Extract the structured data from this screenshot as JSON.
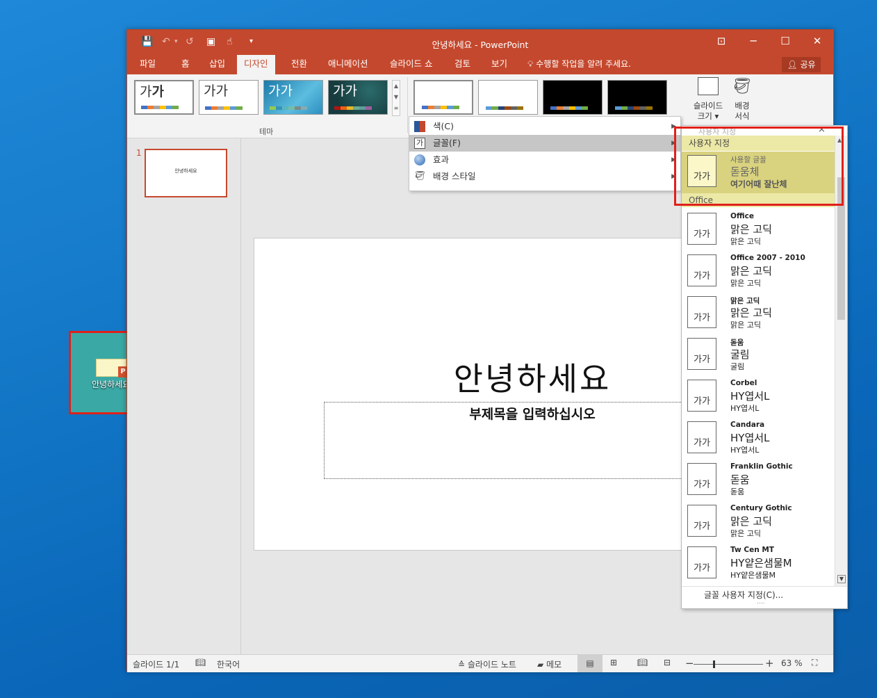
{
  "window": {
    "title": "안녕하세요 - PowerPoint",
    "minimize": "─",
    "maximize": "☐",
    "close": "✕",
    "ribbon_display": "⊡"
  },
  "qat": {
    "save": "💾",
    "undo": "↶",
    "undo_drop": "▾",
    "redo": "↺",
    "present": "▣",
    "touch": "☝",
    "customize": "▾"
  },
  "tabs": [
    "파일",
    "홈",
    "삽입",
    "디자인",
    "전환",
    "애니메이션",
    "슬라이드 쇼",
    "검토",
    "보기"
  ],
  "active_tab": "디자인",
  "tell_me": "수행할 작업을 알려 주세요.",
  "share": "공유",
  "themes": {
    "label": "테마",
    "items": [
      {
        "text": "가가",
        "bold_second": true
      },
      {
        "text": "가가"
      },
      {
        "text": "가가"
      },
      {
        "text": "가가"
      }
    ]
  },
  "customize_group": {
    "slide_size": "슬라이드 크기",
    "format_bg": "배경 서식",
    "size_line1": "슬라이드",
    "size_line2": "크기",
    "bg_line1": "배경",
    "bg_line2": "서식"
  },
  "variant_menu": {
    "items": [
      {
        "label": "색(C)",
        "name": "colors"
      },
      {
        "label": "글꼴(F)",
        "name": "fonts"
      },
      {
        "label": "효과",
        "name": "effects"
      },
      {
        "label": "배경 스타일",
        "name": "bg-styles"
      }
    ]
  },
  "font_panel": {
    "ghost_header": "사용자 지정",
    "custom_header": "사용자 지정",
    "custom_item": {
      "box": "가가",
      "name": "사용할 글꼴",
      "heading": "돋움체",
      "body": "여기어때 잘난체"
    },
    "office_header": "Office",
    "items": [
      {
        "name": "Office",
        "heading": "맑은 고딕",
        "body": "맑은 고딕",
        "box": "가가"
      },
      {
        "name": "Office 2007 - 2010",
        "heading": "맑은 고딕",
        "body": "맑은 고딕",
        "box": "가가"
      },
      {
        "name": "맑은 고딕",
        "heading": "맑은 고딕",
        "body": "맑은 고딕",
        "box": "가가"
      },
      {
        "name": "돋움",
        "heading": "굴림",
        "body": "굴림",
        "box": "가가"
      },
      {
        "name": "Corbel",
        "heading": "HY엽서L",
        "body": "HY엽서L",
        "box": "가가"
      },
      {
        "name": "Candara",
        "heading": "HY엽서L",
        "body": "HY엽서L",
        "box": "가가"
      },
      {
        "name": "Franklin Gothic",
        "heading": "돋움",
        "body": "돋움",
        "box": "가가"
      },
      {
        "name": "Century Gothic",
        "heading": "맑은 고딕",
        "body": "맑은 고딕",
        "box": "가가"
      },
      {
        "name": "Tw Cen MT",
        "heading": "HY얕은샘물M",
        "body": "HY얕은샘물M",
        "box": "가가"
      }
    ],
    "customize_link": "글꼴 사용자 지정(C)...",
    "grip": "....",
    "close": "×"
  },
  "slide_panel": {
    "number": "1",
    "thumb_text": "안녕하세요"
  },
  "slide": {
    "title": "안녕하세요",
    "subtitle": "부제목을 입력하십시오"
  },
  "desktop_icon": {
    "label": "안녕하세요",
    "badge": "P"
  },
  "statusbar": {
    "slide_count": "슬라이드 1/1",
    "language": "한국어",
    "notes": "슬라이드 노트",
    "comments": "메모",
    "zoom": "63 %",
    "zoom_percent": 63
  },
  "colors": {
    "accent": "#c4482d",
    "highlight": "#e0201a",
    "custom_bg": "#ece8a6"
  }
}
